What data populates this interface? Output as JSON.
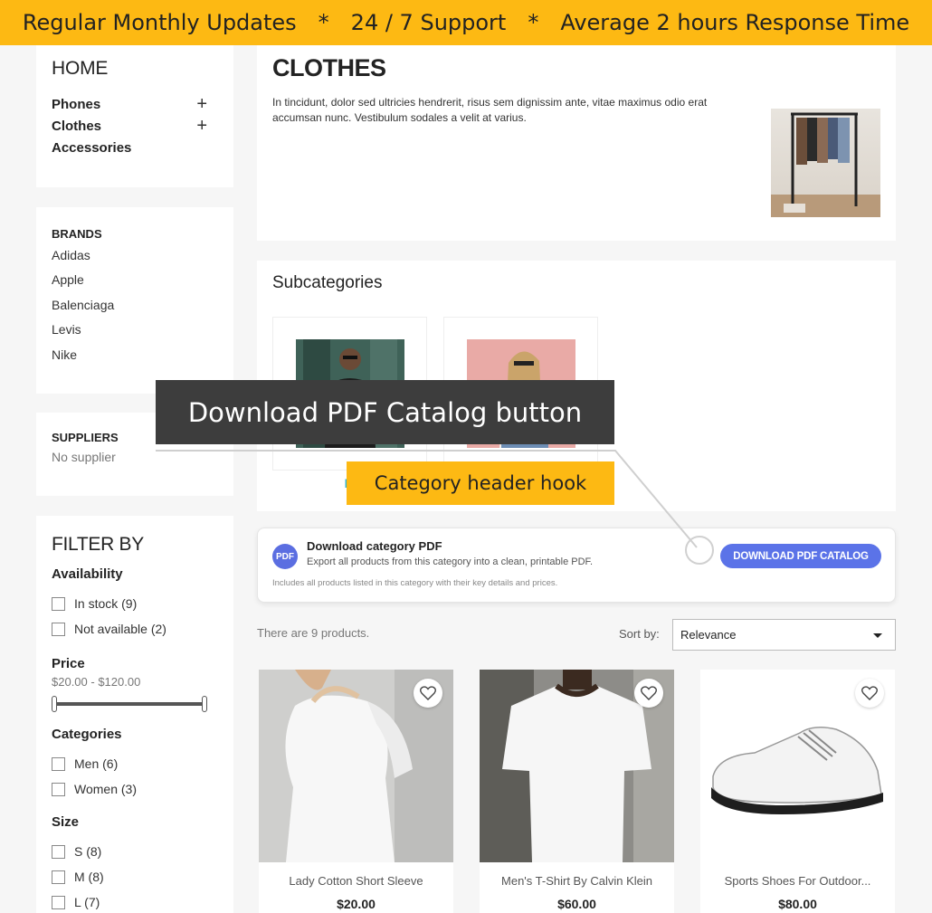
{
  "topbar": {
    "item1": "Regular Monthly Updates",
    "sep1": "*",
    "item2": "24 / 7 Support",
    "sep2": "*",
    "item3": "Average 2 hours Response Time"
  },
  "sidebar": {
    "home_title": "HOME",
    "categories": [
      {
        "label": "Phones",
        "expand": "+"
      },
      {
        "label": "Clothes",
        "expand": "+"
      },
      {
        "label": "Accessories",
        "expand": ""
      }
    ],
    "brands_title": "BRANDS",
    "brands": [
      "Adidas",
      "Apple",
      "Balenciaga",
      "Levis",
      "Nike"
    ],
    "suppliers_title": "SUPPLIERS",
    "suppliers_empty": "No supplier"
  },
  "filters": {
    "title": "FILTER BY",
    "availability_title": "Availability",
    "availability": [
      "In stock (9)",
      "Not available (2)"
    ],
    "price_title": "Price",
    "price_range": "$20.00 - $120.00",
    "price_min_fraction": 0,
    "price_max_fraction": 1,
    "categories_title": "Categories",
    "categories": [
      "Men (6)",
      "Women (3)"
    ],
    "size_title": "Size",
    "sizes": [
      "S (8)",
      "M (8)",
      "L (7)"
    ]
  },
  "category": {
    "title": "CLOTHES",
    "description": "In tincidunt, dolor sed ultricies hendrerit, risus sem dignissim ante, vitae maximus odio erat accumsan nunc. Vestibulum sodales a velit at varius."
  },
  "subcategories": {
    "title": "Subcategories",
    "first_label_visible": "M"
  },
  "pdf": {
    "badge": "PDF",
    "title": "Download category PDF",
    "subtitle": "Export all products from this category into a clean, printable PDF.",
    "note": "Includes all products listed in this category with their key details and prices.",
    "button": "DOWNLOAD PDF CATALOG"
  },
  "listing": {
    "count": "There are 9 products.",
    "sort_label": "Sort by:",
    "sort_value": "Relevance"
  },
  "products": [
    {
      "name": "Lady Cotton Short Sleeve",
      "price": "$20.00"
    },
    {
      "name": "Men's T-Shirt By Calvin Klein",
      "price": "$60.00"
    },
    {
      "name": "Sports Shoes For Outdoor...",
      "price": "$80.00"
    }
  ],
  "callouts": {
    "dark": "Download PDF Catalog button",
    "yellow": "Category header hook"
  },
  "colors": {
    "accent_yellow": "#fdb913",
    "button_blue": "#5b73e8",
    "link_cyan": "#2fb5d2"
  }
}
